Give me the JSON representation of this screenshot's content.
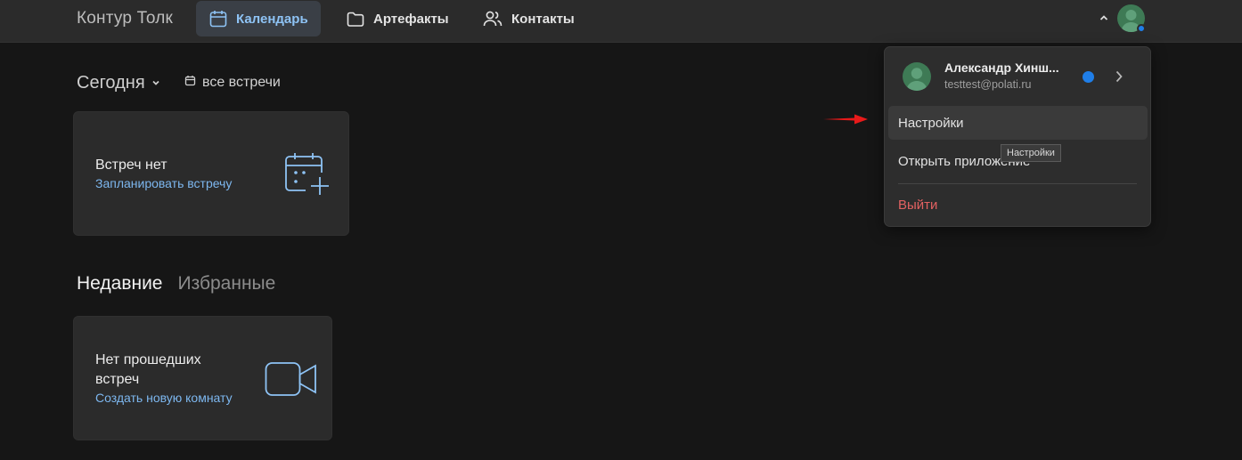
{
  "app": {
    "brand": "Контур Толк"
  },
  "nav": {
    "calendar": "Календарь",
    "artifacts": "Артефакты",
    "contacts": "Контакты"
  },
  "today": {
    "title": "Сегодня",
    "all_meetings": "все встречи"
  },
  "card_meetings": {
    "title": "Встреч нет",
    "link": "Запланировать встречу"
  },
  "tabs": {
    "recent": "Недавние",
    "favorites": "Избранные"
  },
  "card_recent": {
    "title": "Нет прошедших встреч",
    "link": "Создать новую комнату"
  },
  "user_menu": {
    "name": "Александр Хинш...",
    "email": "testtest@polati.ru",
    "settings": "Настройки",
    "open_app": "Открыть приложение",
    "logout": "Выйти",
    "tooltip": "Настройки"
  },
  "colors": {
    "accent": "#7db7ef",
    "status_online": "#1f7ee8",
    "danger": "#e36161",
    "annotation_arrow": "#e81a1a"
  }
}
